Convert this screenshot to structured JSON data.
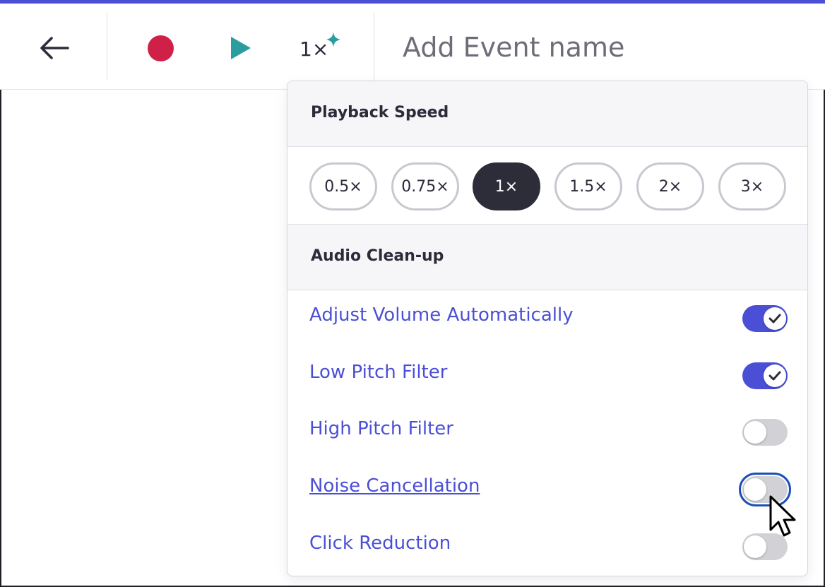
{
  "toolbar": {
    "speed_label": "1×",
    "event_name_placeholder": "Add Event name",
    "icons": {
      "back": "arrow-left-icon",
      "record": "record-icon",
      "play": "play-icon",
      "sparkle": "sparkle-icon"
    },
    "colors": {
      "accent": "#4b4fd6",
      "record": "#cf2148",
      "play": "#2a9d9f",
      "sparkle": "#2a9d9f"
    }
  },
  "dropdown": {
    "playback_speed": {
      "title": "Playback Speed",
      "options": [
        "0.5×",
        "0.75×",
        "1×",
        "1.5×",
        "2×",
        "3×"
      ],
      "selected": "1×"
    },
    "audio_cleanup": {
      "title": "Audio Clean-up",
      "options": [
        {
          "label": "Adjust Volume Automatically",
          "enabled": true
        },
        {
          "label": "Low Pitch Filter",
          "enabled": true
        },
        {
          "label": "High Pitch Filter",
          "enabled": false
        },
        {
          "label": "Noise Cancellation",
          "enabled": false,
          "hovered": true
        },
        {
          "label": "Click Reduction",
          "enabled": false
        }
      ]
    }
  }
}
